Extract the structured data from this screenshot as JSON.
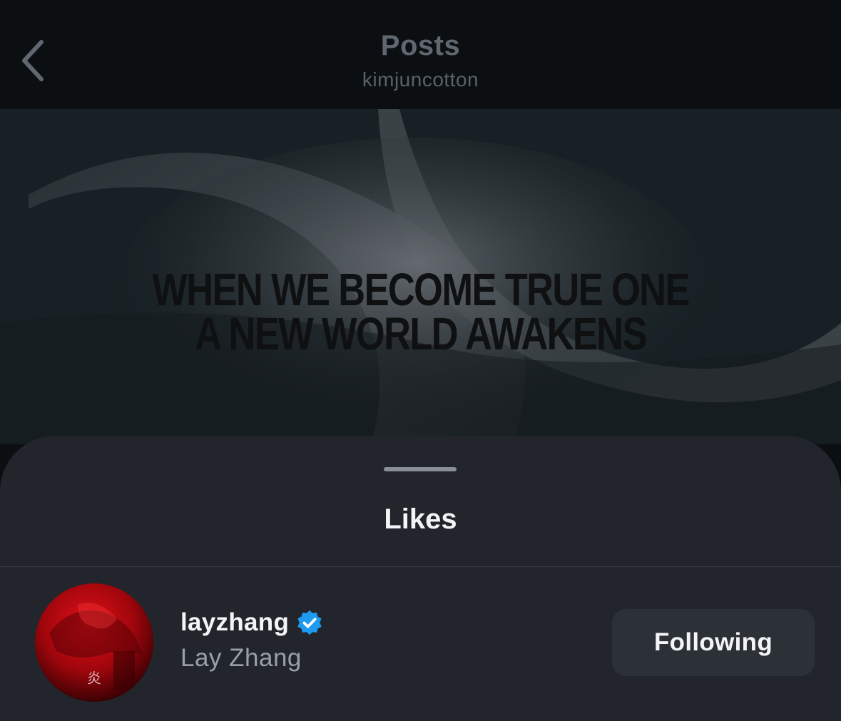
{
  "header": {
    "title": "Posts",
    "subtitle": "kimjuncotton",
    "back_icon": "chevron-left-icon"
  },
  "post": {
    "caption_line1": "WHEN WE BECOME TRUE ONE",
    "caption_line2": "A NEW WORLD AWAKENS"
  },
  "sheet": {
    "title": "Likes",
    "items": [
      {
        "username": "layzhang",
        "verified": true,
        "full_name": "Lay Zhang",
        "follow_label": "Following"
      }
    ]
  },
  "colors": {
    "background": "#0c0f12",
    "sheet": "#22262c",
    "button": "#2c3138",
    "verified": "#1d9bf0",
    "text_primary": "#f3f4f6",
    "text_secondary": "#9aa0a7"
  }
}
